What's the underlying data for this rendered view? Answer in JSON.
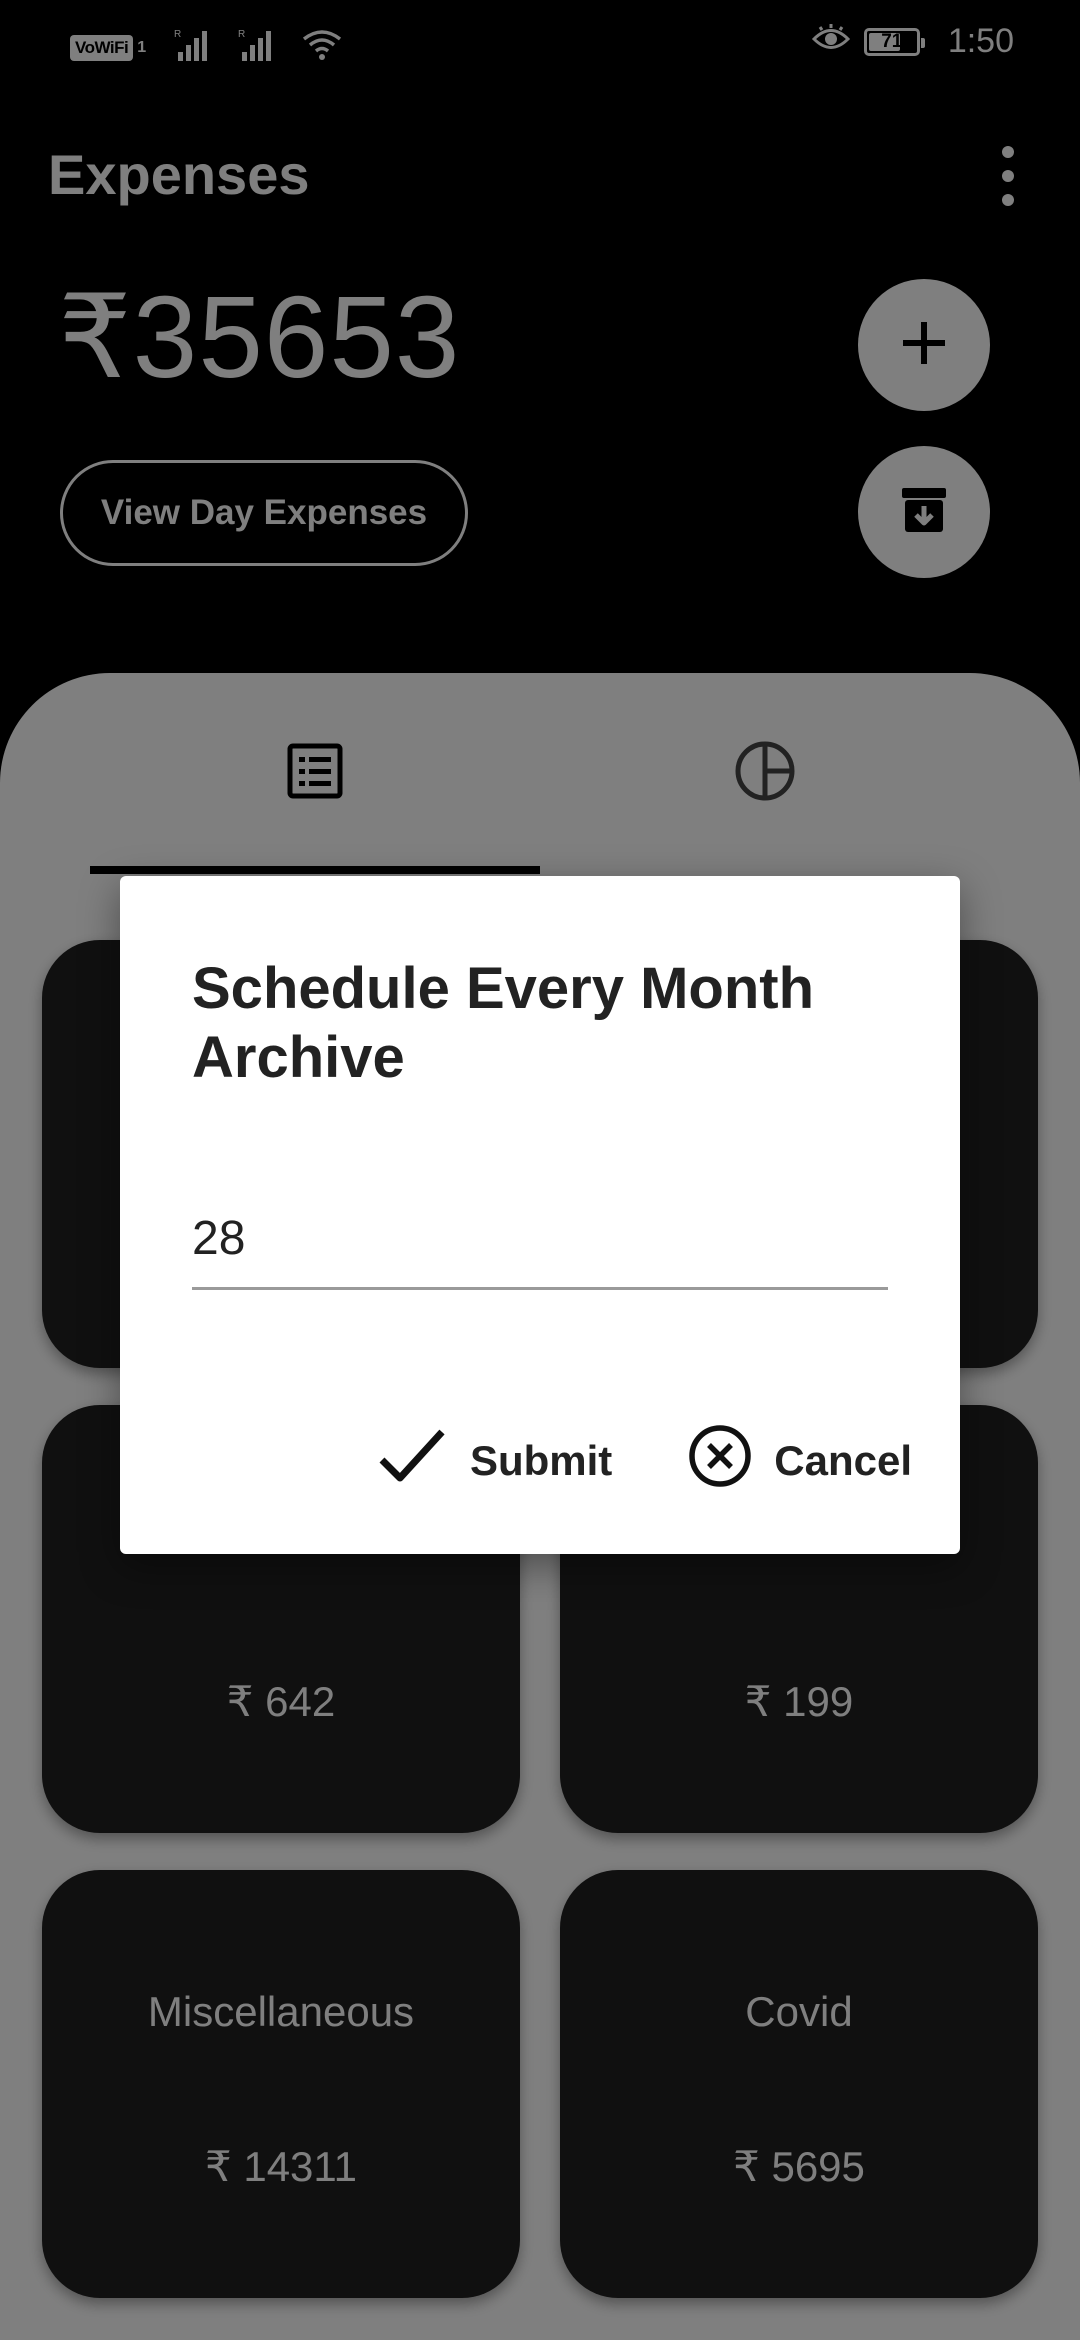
{
  "status_bar": {
    "vowifi": "VoWiFi",
    "sim_slot": "1",
    "battery_level": 71,
    "battery_label": "71",
    "time": "1:50",
    "icons": [
      "signal-icon",
      "signal-icon",
      "wifi-icon",
      "eye-comfort-icon",
      "battery-icon"
    ]
  },
  "header": {
    "title": "Expenses",
    "total_amount": "₹35653",
    "view_day_label": "View Day Expenses",
    "add_icon": "plus-icon",
    "archive_icon": "archive-icon",
    "menu_icon": "more-vert-icon"
  },
  "tabs": [
    {
      "icon": "list-icon",
      "selected": true
    },
    {
      "icon": "pie-chart-icon",
      "selected": false
    }
  ],
  "categories": [
    {
      "name": "",
      "amount": ""
    },
    {
      "name": "",
      "amount": ""
    },
    {
      "name": "",
      "amount": "₹ 642"
    },
    {
      "name": "",
      "amount": "₹ 199"
    },
    {
      "name": "Miscellaneous",
      "amount": "₹ 14311"
    },
    {
      "name": "Covid",
      "amount": "₹ 5695"
    }
  ],
  "dialog": {
    "title": "Schedule Every Month Archive",
    "input_value": "28",
    "submit_label": "Submit",
    "cancel_label": "Cancel",
    "submit_icon": "check-icon",
    "cancel_icon": "cancel-circle-icon"
  },
  "colors": {
    "background": "#000000",
    "sheet": "#ffffff",
    "card": "#202020",
    "dialog": "#ffffff",
    "dialog_text": "#222222"
  }
}
